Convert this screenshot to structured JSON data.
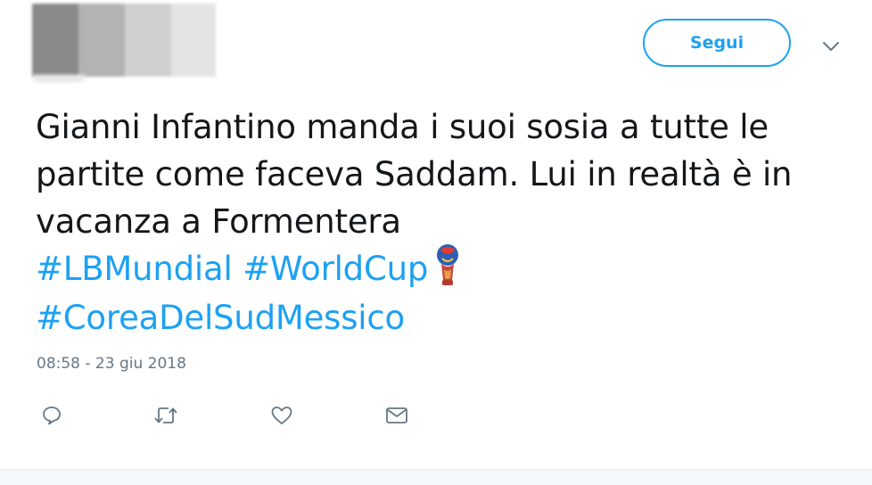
{
  "header": {
    "follow_label": "Segui",
    "caret_icon": "chevron-down-icon"
  },
  "tweet": {
    "lines": [
      "Gianni Infantino manda i suoi sosia a tutte le",
      "partite come faceva Saddam. Lui in realtà è in",
      "vacanza a Formentera"
    ],
    "hashtags": {
      "lbmundial": "#LBMundial",
      "worldcup": "#WorldCup",
      "coreadelsudmessico": "#CoreaDelSudMessico"
    },
    "emoji_icon": "world-cup-trophy-icon",
    "timestamp": "08:58 - 23 giu 2018"
  },
  "actions": {
    "reply_icon": "reply-icon",
    "retweet_icon": "retweet-icon",
    "like_icon": "heart-icon",
    "message_icon": "envelope-icon"
  },
  "colors": {
    "accent": "#1da1f2",
    "text": "#14171a",
    "muted": "#657786"
  }
}
